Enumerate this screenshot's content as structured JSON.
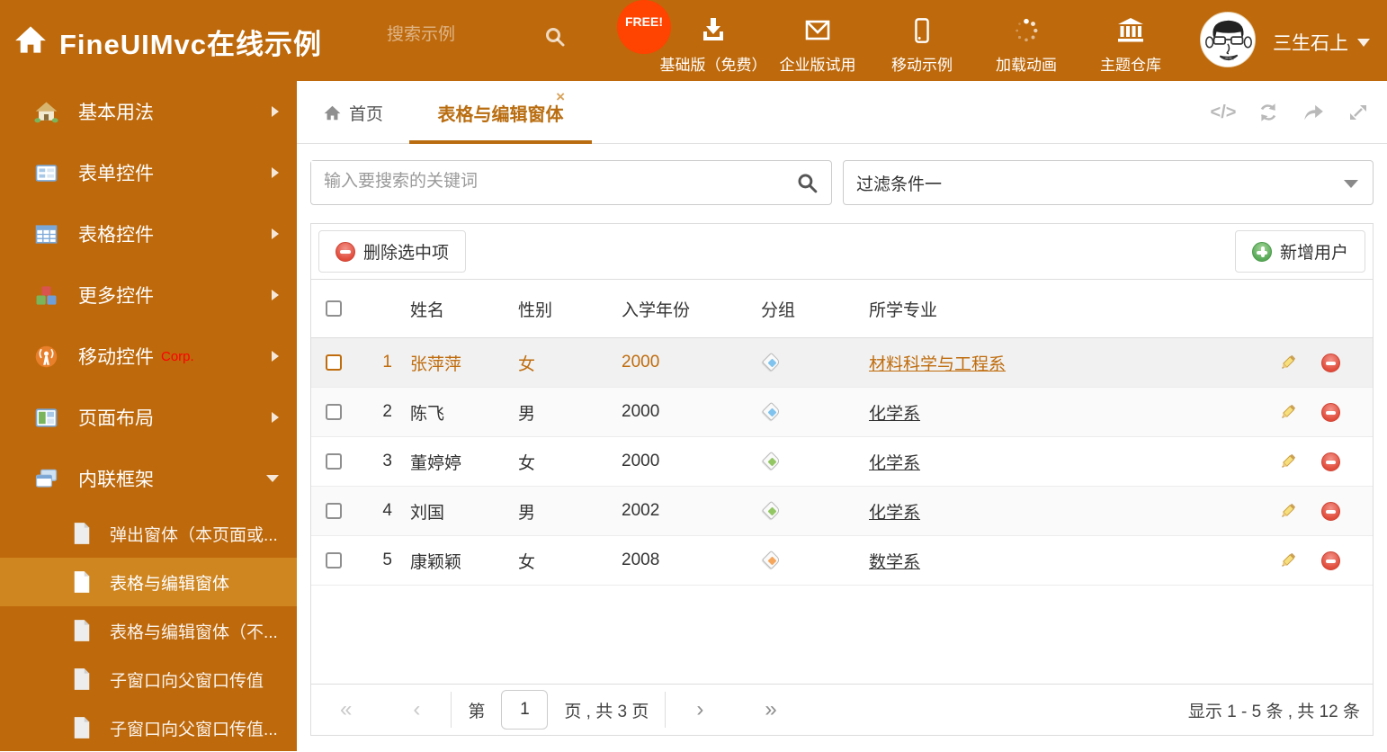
{
  "colors": {
    "accent_orange": "#be690b",
    "sidebar_selected": "#cf8620",
    "active_tab": "#b96d10",
    "free_badge_red": "#ff4300",
    "corp_red": "#ff0000",
    "delete_red": "#e04b3a",
    "add_green": "#57a957",
    "tag_blue": "#7fc3ee",
    "tag_green": "#93c763",
    "tag_orange": "#f6a75e"
  },
  "header": {
    "title": "FineUIMvc在线示例",
    "search_placeholder": "搜索示例",
    "free_badge": "FREE!",
    "nav_items": [
      {
        "icon": "download-icon",
        "label": "基础版（免费）"
      },
      {
        "icon": "envelope-icon",
        "label": "企业版试用"
      },
      {
        "icon": "mobile-icon",
        "label": "移动示例"
      },
      {
        "icon": "spinner-icon",
        "label": "加载动画"
      },
      {
        "icon": "bank-icon",
        "label": "主题仓库"
      }
    ],
    "username": "三生石上"
  },
  "sidebar": {
    "items": [
      {
        "icon": "home-icon",
        "label": "基本用法"
      },
      {
        "icon": "form-icon",
        "label": "表单控件"
      },
      {
        "icon": "table-icon",
        "label": "表格控件"
      },
      {
        "icon": "cubes-icon",
        "label": "更多控件"
      },
      {
        "icon": "antenna-icon",
        "label": "移动控件",
        "badge": "Corp."
      },
      {
        "icon": "layout-icon",
        "label": "页面布局"
      },
      {
        "icon": "frames-icon",
        "label": "内联框架",
        "expanded": true
      }
    ],
    "subitems": [
      {
        "label": "弹出窗体（本页面或..."
      },
      {
        "label": "表格与编辑窗体",
        "active": true
      },
      {
        "label": "表格与编辑窗体（不..."
      },
      {
        "label": "子窗口向父窗口传值"
      },
      {
        "label": "子窗口向父窗口传值..."
      }
    ]
  },
  "tabs": [
    {
      "label": "首页"
    },
    {
      "label": "表格与编辑窗体",
      "close": "×",
      "active": true
    }
  ],
  "icons": {
    "code_glyph": "</>"
  },
  "filter": {
    "search_placeholder": "输入要搜索的关键词",
    "dropdown_value": "过滤条件一"
  },
  "toolbar": {
    "delete_label": "删除选中项",
    "add_label": "新增用户"
  },
  "table": {
    "headers": {
      "name": "姓名",
      "gender": "性别",
      "year": "入学年份",
      "group": "分组",
      "major": "所学专业"
    },
    "rows": [
      {
        "num": "1",
        "name": "张萍萍",
        "gender": "女",
        "year": "2000",
        "tag": "blue",
        "major": "材料科学与工程系",
        "state": "selected"
      },
      {
        "num": "2",
        "name": "陈飞",
        "gender": "男",
        "year": "2000",
        "tag": "blue",
        "major": "化学系",
        "state": "normal"
      },
      {
        "num": "3",
        "name": "董婷婷",
        "gender": "女",
        "year": "2000",
        "tag": "green",
        "major": "化学系",
        "state": "normal"
      },
      {
        "num": "4",
        "name": "刘国",
        "gender": "男",
        "year": "2002",
        "tag": "green",
        "major": "化学系",
        "state": "normal"
      },
      {
        "num": "5",
        "name": "康颖颖",
        "gender": "女",
        "year": "2008",
        "tag": "orange",
        "major": "数学系",
        "state": "normal"
      }
    ]
  },
  "pagination": {
    "first": "«",
    "prev": "‹",
    "page_prefix": "第",
    "page_value": "1",
    "page_suffix": "页 , 共 3 页",
    "next": "›",
    "last": "»",
    "summary": "显示 1 - 5 条 , 共 12 条"
  }
}
